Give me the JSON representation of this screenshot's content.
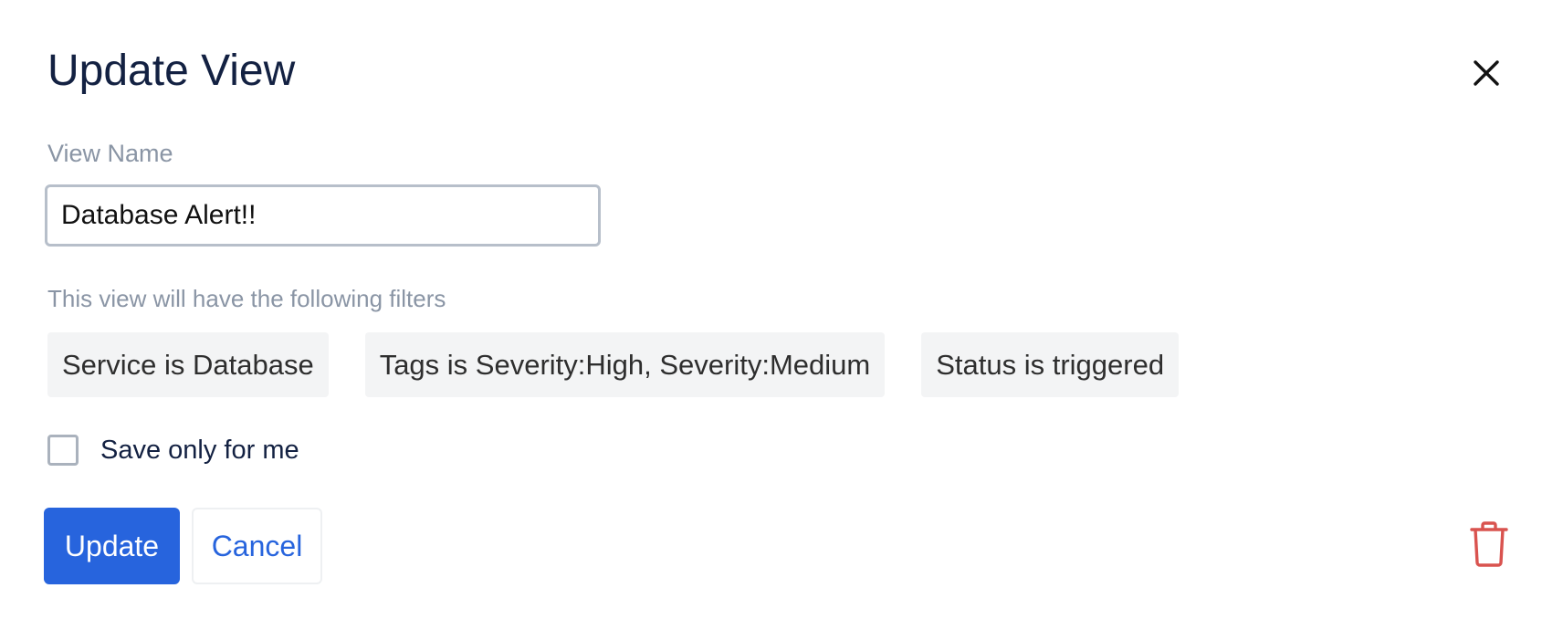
{
  "dialog": {
    "title": "Update View",
    "close_icon": "close-icon"
  },
  "view_name": {
    "label": "View Name",
    "value": "Database Alert!!"
  },
  "filters": {
    "label": "This view will have the following filters",
    "chips": [
      "Service is Database",
      "Tags is Severity:High, Severity:Medium",
      "Status is triggered"
    ]
  },
  "save_only_for_me": {
    "label": "Save only for me",
    "checked": false
  },
  "actions": {
    "update_label": "Update",
    "cancel_label": "Cancel",
    "delete_icon": "trash-icon"
  },
  "colors": {
    "primary": "#2764dd",
    "title": "#132142",
    "muted": "#8a95a5",
    "chip_bg": "#f3f4f5",
    "danger": "#d9534f"
  }
}
